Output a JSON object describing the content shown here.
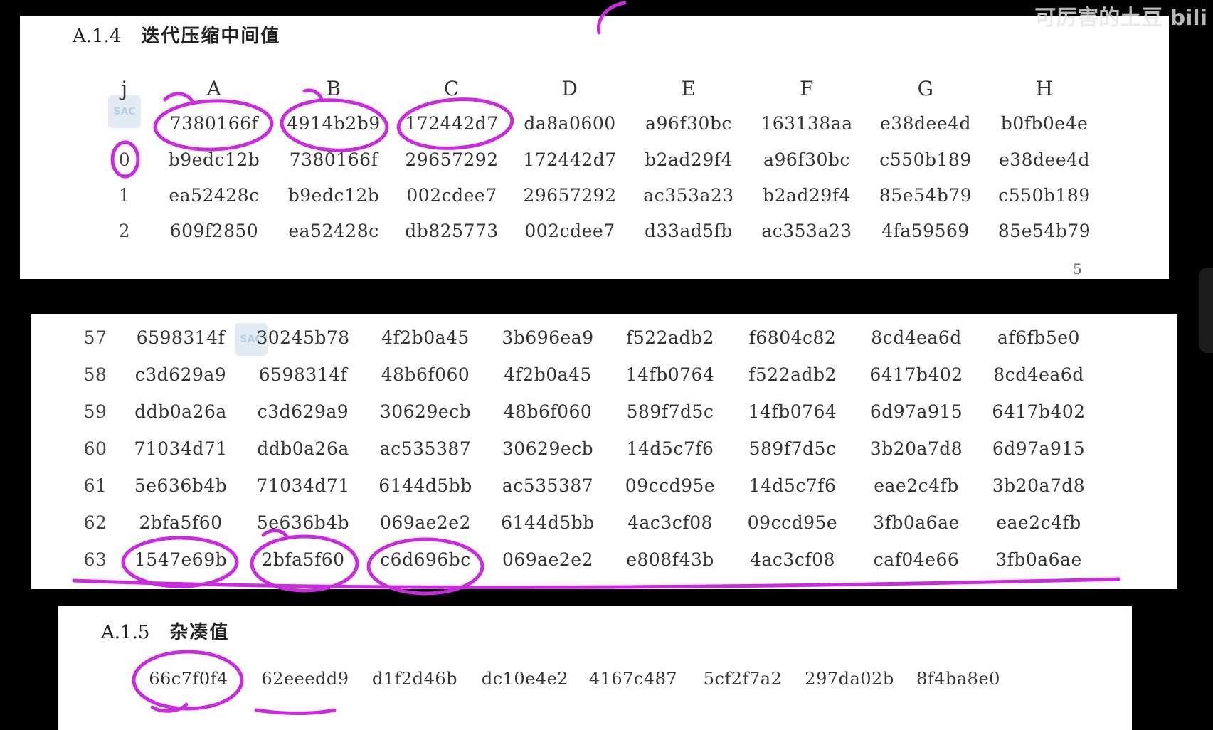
{
  "section1": {
    "number": "A.1.4",
    "title": "迭代压缩中间值",
    "columns": [
      "j",
      "A",
      "B",
      "C",
      "D",
      "E",
      "F",
      "G",
      "H"
    ],
    "rows": [
      [
        "",
        "7380166f",
        "4914b2b9",
        "172442d7",
        "da8a0600",
        "a96f30bc",
        "163138aa",
        "e38dee4d",
        "b0fb0e4e"
      ],
      [
        "0",
        "b9edc12b",
        "7380166f",
        "29657292",
        "172442d7",
        "b2ad29f4",
        "a96f30bc",
        "c550b189",
        "e38dee4d"
      ],
      [
        "1",
        "ea52428c",
        "b9edc12b",
        "002cdee7",
        "29657292",
        "ac353a23",
        "b2ad29f4",
        "85e54b79",
        "c550b189"
      ],
      [
        "2",
        "609f2850",
        "ea52428c",
        "db825773",
        "002cdee7",
        "d33ad5fb",
        "ac353a23",
        "4fa59569",
        "85e54b79"
      ]
    ],
    "page_number": "5"
  },
  "section2": {
    "rows": [
      [
        "57",
        "6598314f",
        "30245b78",
        "4f2b0a45",
        "3b696ea9",
        "f522adb2",
        "f6804c82",
        "8cd4ea6d",
        "af6fb5e0"
      ],
      [
        "58",
        "c3d629a9",
        "6598314f",
        "48b6f060",
        "4f2b0a45",
        "14fb0764",
        "f522adb2",
        "6417b402",
        "8cd4ea6d"
      ],
      [
        "59",
        "ddb0a26a",
        "c3d629a9",
        "30629ecb",
        "48b6f060",
        "589f7d5c",
        "14fb0764",
        "6d97a915",
        "6417b402"
      ],
      [
        "60",
        "71034d71",
        "ddb0a26a",
        "ac535387",
        "30629ecb",
        "14d5c7f6",
        "589f7d5c",
        "3b20a7d8",
        "6d97a915"
      ],
      [
        "61",
        "5e636b4b",
        "71034d71",
        "6144d5bb",
        "ac535387",
        "09ccd95e",
        "14d5c7f6",
        "eae2c4fb",
        "3b20a7d8"
      ],
      [
        "62",
        "2bfa5f60",
        "5e636b4b",
        "069ae2e2",
        "6144d5bb",
        "4ac3cf08",
        "09ccd95e",
        "3fb0a6ae",
        "eae2c4fb"
      ],
      [
        "63",
        "1547e69b",
        "2bfa5f60",
        "c6d696bc",
        "069ae2e2",
        "e808f43b",
        "4ac3cf08",
        "caf04e66",
        "3fb0a6ae"
      ]
    ]
  },
  "section3": {
    "number": "A.1.5",
    "title": "杂凑值",
    "values": [
      "66c7f0f4",
      "62eeedd9",
      "d1f2d46b",
      "dc10e4e2",
      "4167c487",
      "5cf2f7a2",
      "297da02b",
      "8f4ba8e0"
    ]
  },
  "watermark_label": "SAC",
  "brand": "可厉害的土豆 bili",
  "colors": {
    "annotation": "#c82cdc",
    "panel": "#ffffff",
    "background": "#000000",
    "text": "#333333"
  }
}
